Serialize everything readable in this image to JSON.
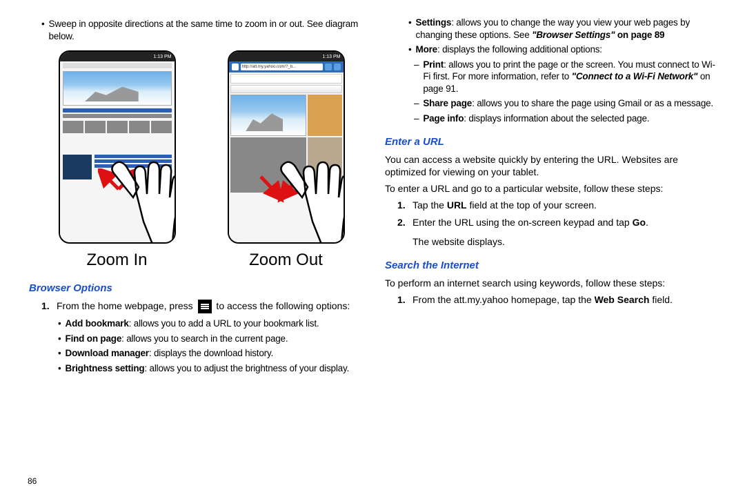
{
  "left": {
    "intro": "Sweep in opposite directions at the same time to zoom in or out. See diagram below.",
    "zoom_in_label": "Zoom In",
    "zoom_out_label": "Zoom Out",
    "phone_time": "1:13 PM",
    "phone_url": "http://att.my.yahoo.com/?_b...",
    "section_browser_options": "Browser Options",
    "step1_num": "1.",
    "step1_pre": "From the home webpage, press ",
    "step1_post": " to access the following options:",
    "opt_add_bookmark_b": "Add bookmark",
    "opt_add_bookmark_t": ": allows you to add a URL to your bookmark list.",
    "opt_find_b": "Find on page",
    "opt_find_t": ": allows you to search in the current page.",
    "opt_dl_b": "Download manager",
    "opt_dl_t": ": displays the download history.",
    "opt_bright_b": "Brightness setting",
    "opt_bright_t": ": allows you to adjust the brightness of your display.",
    "page_number": "86"
  },
  "right": {
    "opt_settings_b": "Settings",
    "opt_settings_t1": ": allows you to change the way you view your web pages by changing these options. See ",
    "opt_settings_ref": "\"Browser Settings\"",
    "opt_settings_t2": " on page 89",
    "opt_more_b": "More",
    "opt_more_t": ": displays the following additional options:",
    "sub_print_b": "Print",
    "sub_print_t1": ": allows you to print the page or the screen. You must connect to Wi-Fi first. For more information, refer to ",
    "sub_print_ref": "\"Connect to a Wi-Fi Network\"",
    "sub_print_t2": "  on page 91.",
    "sub_share_b": "Share page",
    "sub_share_t": ": allows you to share the page using Gmail or as a message.",
    "sub_pageinfo_b": "Page info",
    "sub_pageinfo_t": ": displays information about the selected page.",
    "section_enter_url": "Enter a URL",
    "enter_intro": "You can access a website quickly by entering the URL. Websites are optimized for viewing on your tablet.",
    "enter_steps_intro": "To enter a URL and go to a particular website, follow these steps:",
    "url_step1_num": "1.",
    "url_step1_t1": "Tap the ",
    "url_step1_b": "URL",
    "url_step1_t2": " field at the top of your screen.",
    "url_step2_num": "2.",
    "url_step2_t1": "Enter the URL using the on-screen keypad and tap ",
    "url_step2_b": "Go",
    "url_step2_t2": ".",
    "url_step2_line2": "The website displays.",
    "section_search": "Search the Internet",
    "search_intro": "To perform an internet search using keywords, follow these steps:",
    "search_step1_num": "1.",
    "search_step1_t1": "From the att.my.yahoo homepage, tap the ",
    "search_step1_b": "Web Search",
    "search_step1_t2": " field."
  }
}
